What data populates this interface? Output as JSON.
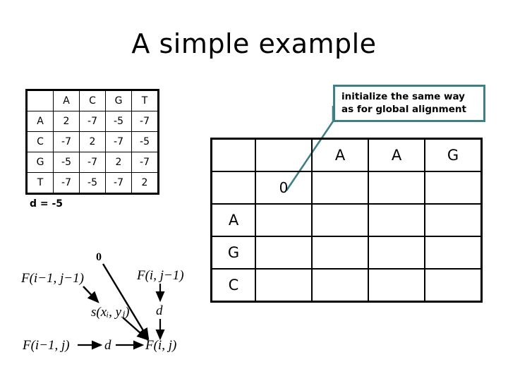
{
  "slide": {
    "title": "A simple example"
  },
  "scoring_matrix": {
    "name": "substitution-matrix",
    "corner_label": "",
    "col_headers": [
      "A",
      "C",
      "G",
      "T"
    ],
    "row_headers": [
      "A",
      "C",
      "G",
      "T"
    ],
    "rows": [
      [
        "2",
        "-7",
        "-5",
        "-7"
      ],
      [
        "-7",
        "2",
        "-7",
        "-5"
      ],
      [
        "-5",
        "-7",
        "2",
        "-7"
      ],
      [
        "-7",
        "-5",
        "-7",
        "2"
      ]
    ],
    "gap_penalty": "d = -5"
  },
  "callout": {
    "line1": "initialize the same way",
    "line2": "as for global alignment",
    "border_color": "#3f7f86",
    "leader_color": "#3f7f86"
  },
  "dp_grid": {
    "name": "dynamic-programming-matrix",
    "col_headers": [
      "",
      "",
      "A",
      "A",
      "G"
    ],
    "rows": [
      {
        "label": "",
        "cells": [
          "0",
          "",
          "",
          ""
        ]
      },
      {
        "label": "A",
        "cells": [
          "",
          "",
          "",
          ""
        ]
      },
      {
        "label": "G",
        "cells": [
          "",
          "",
          "",
          ""
        ]
      },
      {
        "label": "C",
        "cells": [
          "",
          "",
          "",
          ""
        ]
      }
    ]
  },
  "recurrence": {
    "zero": "0",
    "diag_source": "F(i−1, j−1)",
    "up_source": "F(i, j−1)",
    "left_source": "F(i−1, j)",
    "target": "F(i, j)",
    "score_term": "s(xᵢ, yⱼ)",
    "gap_term_vertical": "d",
    "gap_term_horizontal": "d"
  }
}
